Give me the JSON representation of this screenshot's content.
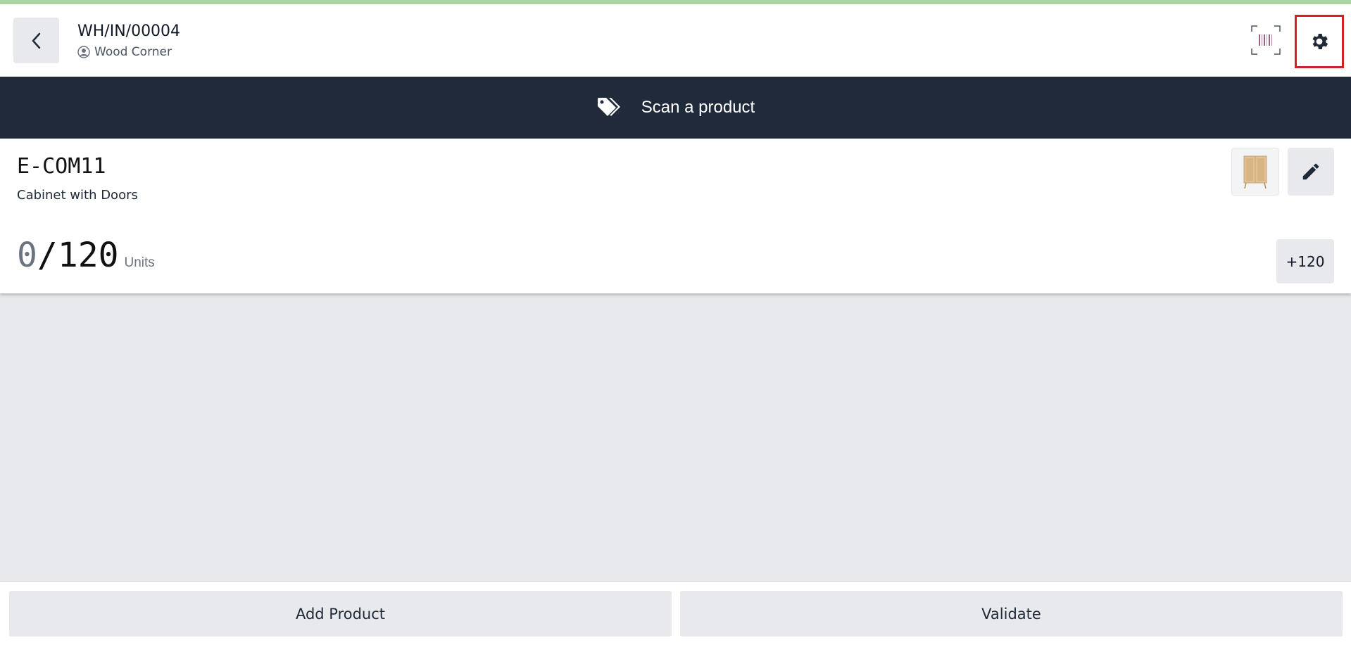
{
  "header": {
    "reference": "WH/IN/00004",
    "partner": "Wood Corner"
  },
  "banner": {
    "instruction": "Scan a product"
  },
  "line": {
    "product_code": "E-COM11",
    "product_name": "Cabinet with Doors",
    "qty_done": "0",
    "qty_separator": "/",
    "qty_total": "120",
    "uom": "Units",
    "add_all_label": "+120"
  },
  "footer": {
    "add_product_label": "Add Product",
    "validate_label": "Validate"
  },
  "icons": {
    "back": "chevron-left-icon",
    "partner": "user-circle-icon",
    "barcode": "barcode-scanner-icon",
    "settings": "gear-icon",
    "banner": "tags-icon",
    "product_image": "cabinet-image",
    "edit": "pencil-icon"
  },
  "colors": {
    "banner_bg": "#202a3a",
    "highlight": "#d0202a",
    "progress": "#a9d3a0"
  }
}
